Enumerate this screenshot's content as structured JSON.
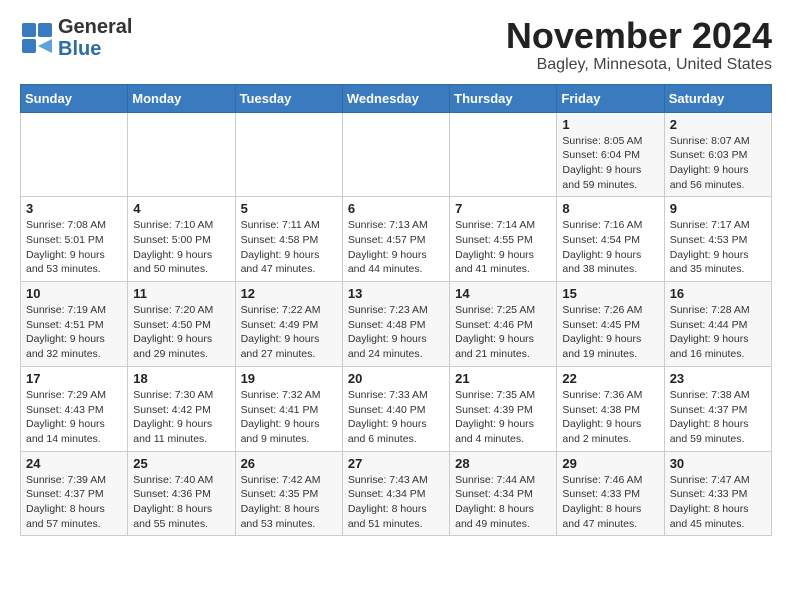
{
  "logo": {
    "general": "General",
    "blue": "Blue"
  },
  "title": "November 2024",
  "subtitle": "Bagley, Minnesota, United States",
  "days_of_week": [
    "Sunday",
    "Monday",
    "Tuesday",
    "Wednesday",
    "Thursday",
    "Friday",
    "Saturday"
  ],
  "weeks": [
    [
      {
        "day": "",
        "info": ""
      },
      {
        "day": "",
        "info": ""
      },
      {
        "day": "",
        "info": ""
      },
      {
        "day": "",
        "info": ""
      },
      {
        "day": "",
        "info": ""
      },
      {
        "day": "1",
        "info": "Sunrise: 8:05 AM\nSunset: 6:04 PM\nDaylight: 9 hours and 59 minutes."
      },
      {
        "day": "2",
        "info": "Sunrise: 8:07 AM\nSunset: 6:03 PM\nDaylight: 9 hours and 56 minutes."
      }
    ],
    [
      {
        "day": "3",
        "info": "Sunrise: 7:08 AM\nSunset: 5:01 PM\nDaylight: 9 hours and 53 minutes."
      },
      {
        "day": "4",
        "info": "Sunrise: 7:10 AM\nSunset: 5:00 PM\nDaylight: 9 hours and 50 minutes."
      },
      {
        "day": "5",
        "info": "Sunrise: 7:11 AM\nSunset: 4:58 PM\nDaylight: 9 hours and 47 minutes."
      },
      {
        "day": "6",
        "info": "Sunrise: 7:13 AM\nSunset: 4:57 PM\nDaylight: 9 hours and 44 minutes."
      },
      {
        "day": "7",
        "info": "Sunrise: 7:14 AM\nSunset: 4:55 PM\nDaylight: 9 hours and 41 minutes."
      },
      {
        "day": "8",
        "info": "Sunrise: 7:16 AM\nSunset: 4:54 PM\nDaylight: 9 hours and 38 minutes."
      },
      {
        "day": "9",
        "info": "Sunrise: 7:17 AM\nSunset: 4:53 PM\nDaylight: 9 hours and 35 minutes."
      }
    ],
    [
      {
        "day": "10",
        "info": "Sunrise: 7:19 AM\nSunset: 4:51 PM\nDaylight: 9 hours and 32 minutes."
      },
      {
        "day": "11",
        "info": "Sunrise: 7:20 AM\nSunset: 4:50 PM\nDaylight: 9 hours and 29 minutes."
      },
      {
        "day": "12",
        "info": "Sunrise: 7:22 AM\nSunset: 4:49 PM\nDaylight: 9 hours and 27 minutes."
      },
      {
        "day": "13",
        "info": "Sunrise: 7:23 AM\nSunset: 4:48 PM\nDaylight: 9 hours and 24 minutes."
      },
      {
        "day": "14",
        "info": "Sunrise: 7:25 AM\nSunset: 4:46 PM\nDaylight: 9 hours and 21 minutes."
      },
      {
        "day": "15",
        "info": "Sunrise: 7:26 AM\nSunset: 4:45 PM\nDaylight: 9 hours and 19 minutes."
      },
      {
        "day": "16",
        "info": "Sunrise: 7:28 AM\nSunset: 4:44 PM\nDaylight: 9 hours and 16 minutes."
      }
    ],
    [
      {
        "day": "17",
        "info": "Sunrise: 7:29 AM\nSunset: 4:43 PM\nDaylight: 9 hours and 14 minutes."
      },
      {
        "day": "18",
        "info": "Sunrise: 7:30 AM\nSunset: 4:42 PM\nDaylight: 9 hours and 11 minutes."
      },
      {
        "day": "19",
        "info": "Sunrise: 7:32 AM\nSunset: 4:41 PM\nDaylight: 9 hours and 9 minutes."
      },
      {
        "day": "20",
        "info": "Sunrise: 7:33 AM\nSunset: 4:40 PM\nDaylight: 9 hours and 6 minutes."
      },
      {
        "day": "21",
        "info": "Sunrise: 7:35 AM\nSunset: 4:39 PM\nDaylight: 9 hours and 4 minutes."
      },
      {
        "day": "22",
        "info": "Sunrise: 7:36 AM\nSunset: 4:38 PM\nDaylight: 9 hours and 2 minutes."
      },
      {
        "day": "23",
        "info": "Sunrise: 7:38 AM\nSunset: 4:37 PM\nDaylight: 8 hours and 59 minutes."
      }
    ],
    [
      {
        "day": "24",
        "info": "Sunrise: 7:39 AM\nSunset: 4:37 PM\nDaylight: 8 hours and 57 minutes."
      },
      {
        "day": "25",
        "info": "Sunrise: 7:40 AM\nSunset: 4:36 PM\nDaylight: 8 hours and 55 minutes."
      },
      {
        "day": "26",
        "info": "Sunrise: 7:42 AM\nSunset: 4:35 PM\nDaylight: 8 hours and 53 minutes."
      },
      {
        "day": "27",
        "info": "Sunrise: 7:43 AM\nSunset: 4:34 PM\nDaylight: 8 hours and 51 minutes."
      },
      {
        "day": "28",
        "info": "Sunrise: 7:44 AM\nSunset: 4:34 PM\nDaylight: 8 hours and 49 minutes."
      },
      {
        "day": "29",
        "info": "Sunrise: 7:46 AM\nSunset: 4:33 PM\nDaylight: 8 hours and 47 minutes."
      },
      {
        "day": "30",
        "info": "Sunrise: 7:47 AM\nSunset: 4:33 PM\nDaylight: 8 hours and 45 minutes."
      }
    ]
  ]
}
